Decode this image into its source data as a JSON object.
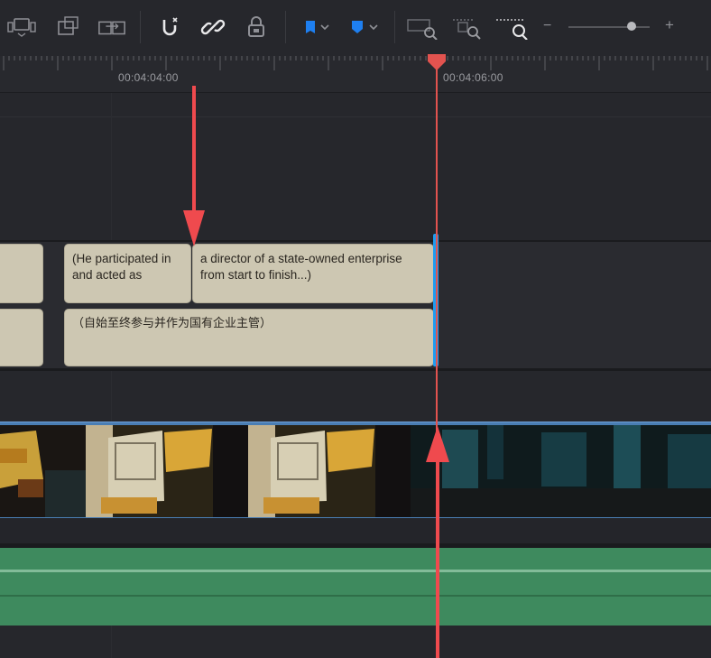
{
  "toolbar": {
    "icons": [
      "mode-icon",
      "overwrite-icon",
      "replace-icon",
      "snapping-icon",
      "link-icon",
      "lock-icon",
      "blue-flag-icon",
      "flag-chevron-icon",
      "blue-marker-icon",
      "marker-chevron-icon",
      "zoom-full-icon",
      "zoom-detail-icon",
      "zoom-custom-icon"
    ],
    "zoom_minus": "−",
    "zoom_plus": "+",
    "zoom_level": 0.78
  },
  "ruler": {
    "timecodes": [
      "00:04:04:00",
      "00:04:06:00"
    ]
  },
  "subtitles": {
    "track1": [
      {
        "text": ""
      },
      {
        "text": "(He participated in and acted as"
      },
      {
        "text": "a director of a state-owned enterprise from start to finish...)"
      }
    ],
    "track2": [
      {
        "text": ""
      },
      {
        "text": "（自始至终参与并作为国有企业主管）"
      }
    ]
  },
  "colors": {
    "playhead": "#e2534f",
    "annotation_arrow": "#ef4a4e",
    "subtitle_clip": "#cdc7b2",
    "clip_end_marker": "#1e9cf0",
    "video_track": "#4a7eb4",
    "audio_track": "#3e8a5e"
  }
}
